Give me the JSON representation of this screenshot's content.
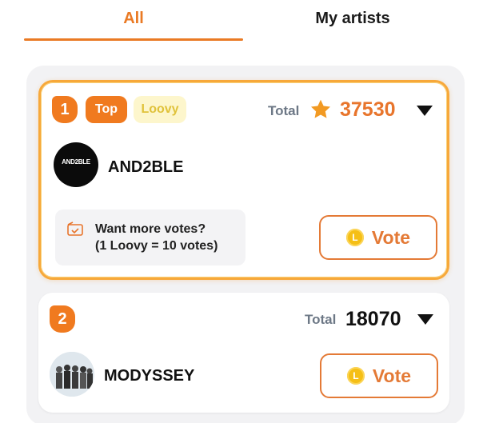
{
  "tabs": [
    {
      "label": "All",
      "active": true
    },
    {
      "label": "My artists",
      "active": false
    }
  ],
  "colors": {
    "accent": "#ea7a24",
    "badge": "#f07a1f",
    "loovy_tag_bg": "#fdf6cc",
    "coin": "#f5bf16"
  },
  "ranking": [
    {
      "rank": "1",
      "tags": [
        "Top",
        "Loovy"
      ],
      "total_label": "Total",
      "total_icon": "star-icon",
      "total": "37530",
      "artist": "AND2BLE",
      "avatar_text": "AND2BLE",
      "promo": {
        "line1": "Want more votes?",
        "line2": "(1 Loovy = 10 votes)",
        "icon": "ticket-icon"
      },
      "vote_label": "Vote",
      "coin_glyph": "L"
    },
    {
      "rank": "2",
      "total_label": "Total",
      "total": "18070",
      "artist": "MODYSSEY",
      "vote_label": "Vote",
      "coin_glyph": "L"
    }
  ]
}
